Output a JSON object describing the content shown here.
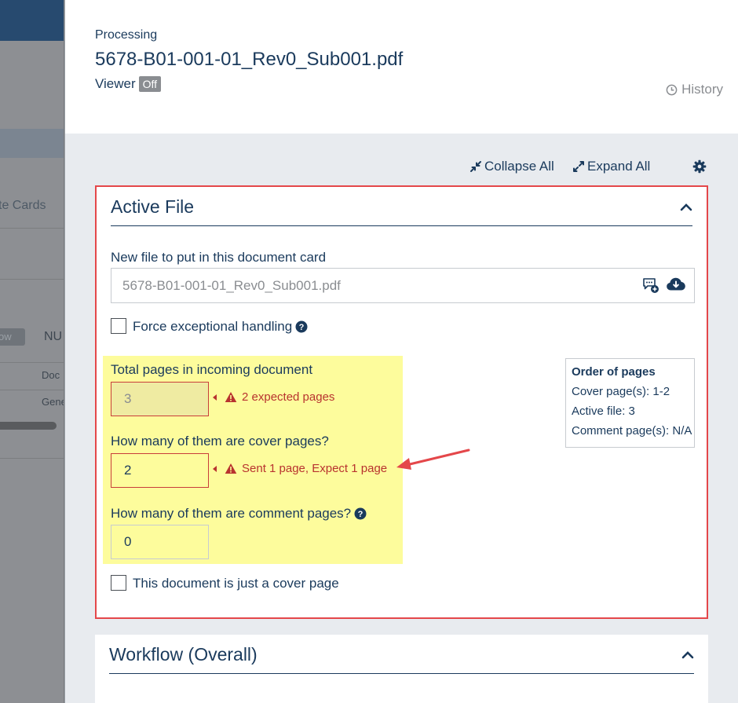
{
  "background": {
    "partial_tab": "te Cards",
    "partial_button": "ow",
    "partial_nu": "NU",
    "partial_col1": "Doc",
    "partial_col2": "Gene"
  },
  "header": {
    "eyebrow": "Processing",
    "title": "5678-B01-001-01_Rev0_Sub001.pdf",
    "viewer_label": "Viewer",
    "viewer_state": "Off",
    "history_label": "History"
  },
  "toolbar": {
    "collapse_all": "Collapse All",
    "expand_all": "Expand All",
    "settings_icon": "gear-icon"
  },
  "active_file": {
    "title": "Active File",
    "new_file_label": "New file to put in this document card",
    "new_file_value": "5678-B01-001-01_Rev0_Sub001.pdf",
    "force_label": "Force exceptional handling",
    "total_pages_label": "Total pages in incoming document",
    "total_pages_value": "3",
    "total_pages_error": "2 expected pages",
    "cover_pages_label": "How many of them are cover pages?",
    "cover_pages_value": "2",
    "cover_pages_error": "Sent 1 page, Expect 1 page",
    "comment_pages_label": "How many of them are comment pages?",
    "comment_pages_value": "0",
    "just_cover_label": "This document is just a cover page",
    "order": {
      "title": "Order of pages",
      "cover": "Cover page(s): 1-2",
      "active": "Active file: 3",
      "comment": "Comment page(s): N/A"
    }
  },
  "workflow": {
    "title": "Workflow (Overall)"
  },
  "colors": {
    "primary": "#1a3a5c",
    "error": "#b8332f",
    "card_border": "#e4474a",
    "highlight": "#fdfc9c",
    "annotation_arrow": "#e4474a"
  }
}
